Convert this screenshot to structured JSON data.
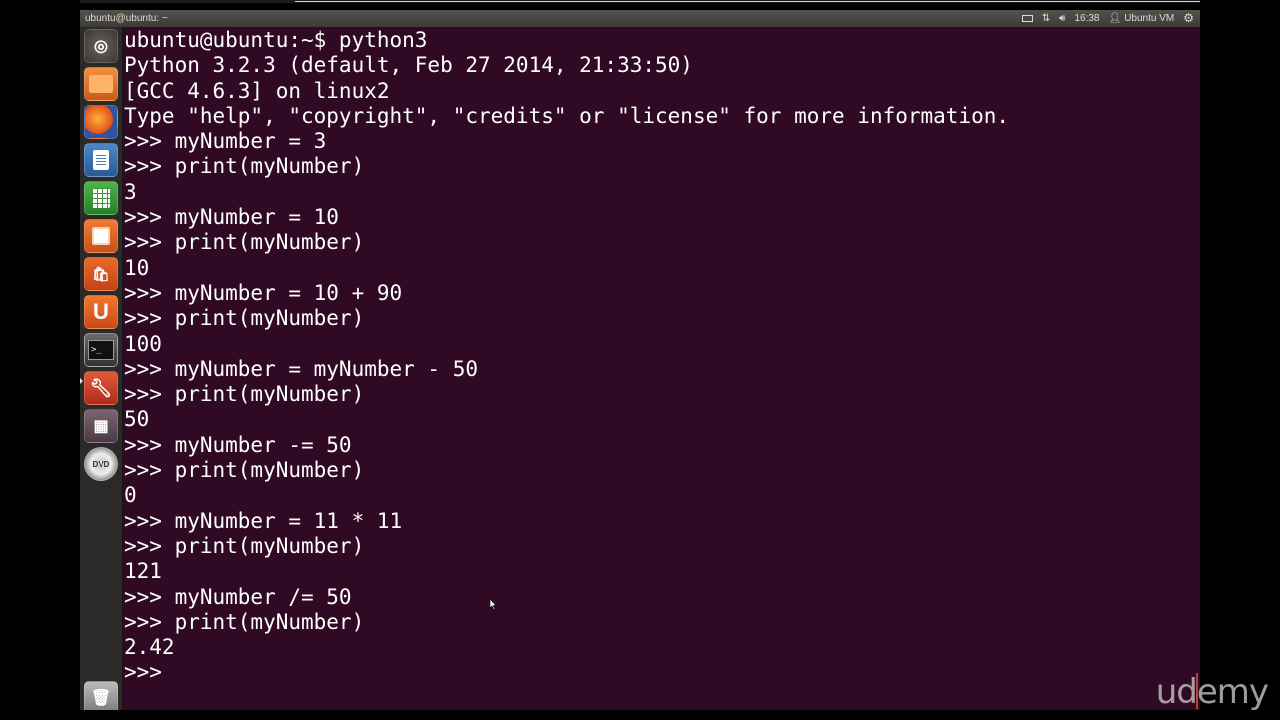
{
  "panel": {
    "window_title": "ubuntu@ubuntu: ~",
    "clock": "16:38",
    "user": "Ubuntu VM",
    "icons": [
      "mail-icon",
      "network-icon",
      "volume-icon",
      "user-icon",
      "gear-icon"
    ]
  },
  "launcher": {
    "items": [
      "dash-home",
      "files",
      "firefox",
      "libreoffice-writer",
      "libreoffice-calc",
      "libreoffice-impress",
      "software-center",
      "ubuntu-one",
      "terminal",
      "system-settings",
      "workspace-switcher",
      "dvd",
      "trash"
    ],
    "dvd_label": "DVD",
    "ubuntu_one_label": "U",
    "terminal_label": ">_"
  },
  "terminal": {
    "lines": [
      "ubuntu@ubuntu:~$ python3",
      "Python 3.2.3 (default, Feb 27 2014, 21:33:50)",
      "[GCC 4.6.3] on linux2",
      "Type \"help\", \"copyright\", \"credits\" or \"license\" for more information.",
      ">>> myNumber = 3",
      ">>> print(myNumber)",
      "3",
      ">>> myNumber = 10",
      ">>> print(myNumber)",
      "10",
      ">>> myNumber = 10 + 90",
      ">>> print(myNumber)",
      "100",
      ">>> myNumber = myNumber - 50",
      ">>> print(myNumber)",
      "50",
      ">>> myNumber -= 50",
      ">>> print(myNumber)",
      "0",
      ">>> myNumber = 11 * 11",
      ">>> print(myNumber)",
      "121",
      ">>> myNumber /= 50",
      ">>> print(myNumber)",
      "2.42",
      ">>> "
    ]
  },
  "watermark": {
    "left": "ud",
    "right": "emy"
  },
  "colors": {
    "terminal_bg": "#300a24",
    "launcher_bg": "#2b2a28",
    "panel_bg": "#3c3b37",
    "accent": "#e3573a"
  }
}
